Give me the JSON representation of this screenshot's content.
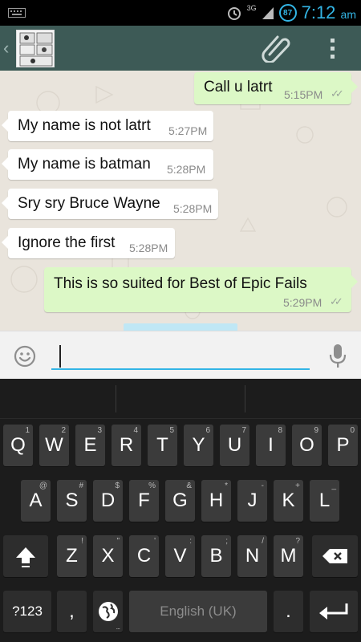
{
  "status_bar": {
    "network": "3G",
    "battery": "87",
    "time": "7:12",
    "ampm": "am"
  },
  "action_bar": {
    "back_icon": "chevron-left-icon",
    "attach_icon": "paperclip-icon",
    "menu_icon": "overflow-menu-icon"
  },
  "messages": [
    {
      "dir": "out",
      "text": "Call u latrt",
      "time": "5:15PM",
      "status": "read-ticks"
    },
    {
      "dir": "in",
      "text": "My name is not latrt",
      "time": "5:27PM"
    },
    {
      "dir": "in",
      "text": "My name is batman",
      "time": "5:28PM"
    },
    {
      "dir": "in",
      "text": "Sry sry Bruce Wayne",
      "time": "5:28PM"
    },
    {
      "dir": "in",
      "text": "Ignore the first",
      "time": "5:28PM"
    },
    {
      "dir": "out",
      "text": "This is so suited for Best of Epic Fails",
      "time": "5:29PM",
      "status": "read-ticks"
    }
  ],
  "input": {
    "value": "",
    "emoji_icon": "smiley-icon",
    "mic_icon": "microphone-icon"
  },
  "keyboard": {
    "row1": [
      {
        "k": "Q",
        "h": "1"
      },
      {
        "k": "W",
        "h": "2"
      },
      {
        "k": "E",
        "h": "3"
      },
      {
        "k": "R",
        "h": "4"
      },
      {
        "k": "T",
        "h": "5"
      },
      {
        "k": "Y",
        "h": "6"
      },
      {
        "k": "U",
        "h": "7"
      },
      {
        "k": "I",
        "h": "8"
      },
      {
        "k": "O",
        "h": "9"
      },
      {
        "k": "P",
        "h": "0"
      }
    ],
    "row2": [
      {
        "k": "A",
        "h": "@"
      },
      {
        "k": "S",
        "h": "#"
      },
      {
        "k": "D",
        "h": "$"
      },
      {
        "k": "F",
        "h": "%"
      },
      {
        "k": "G",
        "h": "&"
      },
      {
        "k": "H",
        "h": "*"
      },
      {
        "k": "J",
        "h": "-"
      },
      {
        "k": "K",
        "h": "+"
      },
      {
        "k": "L",
        "h": "_"
      }
    ],
    "row3": [
      {
        "k": "Z",
        "h": "!"
      },
      {
        "k": "X",
        "h": "\""
      },
      {
        "k": "C",
        "h": "'"
      },
      {
        "k": "V",
        "h": ":"
      },
      {
        "k": "B",
        "h": ";"
      },
      {
        "k": "N",
        "h": "/"
      },
      {
        "k": "M",
        "h": "?"
      }
    ],
    "symbols_label": "?123",
    "comma_label": ",",
    "space_label": "English (UK)",
    "period_label": ".",
    "shift_icon": "shift-arrow-icon",
    "backspace_icon": "backspace-icon",
    "globe_icon": "globe-icon",
    "enter_icon": "enter-arrow-icon"
  },
  "colors": {
    "action_bar": "#3d5a56",
    "accent": "#33b5e5",
    "bubble_out": "#dcf8c6",
    "bubble_in": "#ffffff",
    "chat_bg": "#e9e4dc"
  }
}
